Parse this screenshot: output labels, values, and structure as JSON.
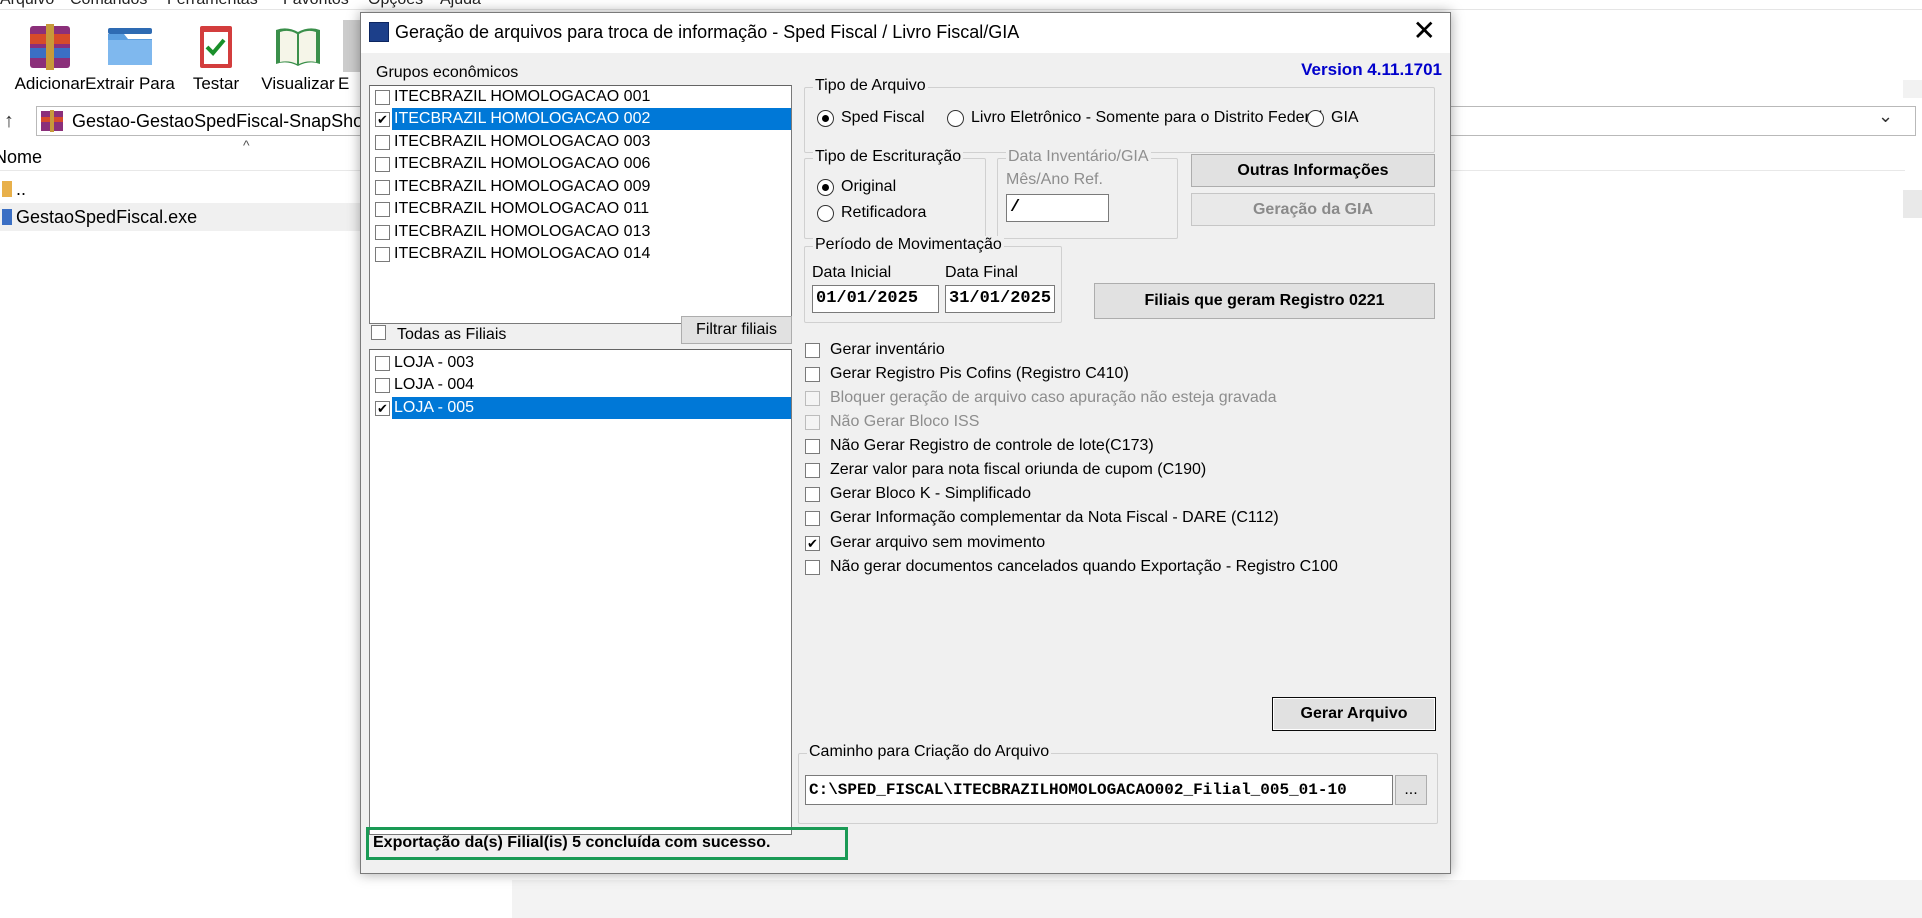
{
  "background_app": {
    "menu": [
      "Arquivo",
      "Comandos",
      "Ferramentas",
      "Favoritos",
      "Opções",
      "Ajuda"
    ],
    "toolbar": [
      {
        "label": "Adicionar",
        "icon": "add-archive-icon"
      },
      {
        "label": "Extrair Para",
        "icon": "extract-folder-icon"
      },
      {
        "label": "Testar",
        "icon": "test-clipboard-icon"
      },
      {
        "label": "Visualizar",
        "icon": "view-book-icon"
      },
      {
        "label": "E",
        "icon": "delete-icon"
      }
    ],
    "address": "Gestao-GestaoSpedFiscal-SnapShot.",
    "column_name": "Nome",
    "files": [
      "..",
      "GestaoSpedFiscal.exe"
    ]
  },
  "dialog": {
    "title": "Geração de arquivos para troca de informação - Sped Fiscal / Livro Fiscal/GIA",
    "version": "Version 4.11.1701",
    "groups_label": "Grupos econômicos",
    "groups": [
      {
        "label": "ITECBRAZIL HOMOLOGACAO 001",
        "checked": false,
        "selected": false
      },
      {
        "label": "ITECBRAZIL HOMOLOGACAO 002",
        "checked": true,
        "selected": true
      },
      {
        "label": "ITECBRAZIL HOMOLOGACAO 003",
        "checked": false,
        "selected": false
      },
      {
        "label": "ITECBRAZIL HOMOLOGACAO 006",
        "checked": false,
        "selected": false
      },
      {
        "label": "ITECBRAZIL HOMOLOGACAO 009",
        "checked": false,
        "selected": false
      },
      {
        "label": "ITECBRAZIL HOMOLOGACAO 011",
        "checked": false,
        "selected": false
      },
      {
        "label": "ITECBRAZIL HOMOLOGACAO 013",
        "checked": false,
        "selected": false
      },
      {
        "label": "ITECBRAZIL HOMOLOGACAO 014",
        "checked": false,
        "selected": false
      }
    ],
    "all_branches_label": "Todas as Filiais",
    "filter_button": "Filtrar filiais",
    "branches": [
      {
        "label": "LOJA - 003",
        "checked": false,
        "selected": false
      },
      {
        "label": "LOJA - 004",
        "checked": false,
        "selected": false
      },
      {
        "label": "LOJA - 005",
        "checked": true,
        "selected": true
      }
    ],
    "file_type": {
      "title": "Tipo de Arquivo",
      "options": [
        "Sped Fiscal",
        "Livro Eletrônico - Somente para o Distrito Federal",
        "GIA"
      ],
      "selected": "Sped Fiscal"
    },
    "bookkeeping": {
      "title": "Tipo de Escrituração",
      "options": [
        "Original",
        "Retificadora"
      ],
      "selected": "Original"
    },
    "inventory": {
      "title": "Data Inventário/GIA",
      "month_label": "Mês/Ano Ref.",
      "value": "/"
    },
    "other_info_button": "Outras Informações",
    "gia_button": "Geração da GIA",
    "period": {
      "title": "Período de Movimentação",
      "start_label": "Data Inicial",
      "end_label": "Data Final",
      "start": "01/01/2025",
      "end": "31/01/2025"
    },
    "branches_0221_button": "Filiais que geram Registro 0221",
    "options": [
      {
        "label": "Gerar inventário",
        "checked": false,
        "enabled": true
      },
      {
        "label": "Gerar Registro Pis Cofins (Registro C410)",
        "checked": false,
        "enabled": true
      },
      {
        "label": "Bloquer geração de arquivo caso apuração não esteja gravada",
        "checked": false,
        "enabled": false
      },
      {
        "label": "Não Gerar Bloco ISS",
        "checked": false,
        "enabled": false
      },
      {
        "label": "Não Gerar Registro de controle de lote(C173)",
        "checked": false,
        "enabled": true
      },
      {
        "label": "Zerar valor para nota fiscal oriunda de cupom (C190)",
        "checked": false,
        "enabled": true
      },
      {
        "label": "Gerar Bloco K  -  Simplificado",
        "checked": false,
        "enabled": true
      },
      {
        "label": "Gerar Informação complementar da Nota Fiscal - DARE (C112)",
        "checked": false,
        "enabled": true
      },
      {
        "label": "Gerar arquivo sem movimento",
        "checked": true,
        "enabled": true
      },
      {
        "label": "Não gerar documentos cancelados quando Exportação - Registro C100",
        "checked": false,
        "enabled": true
      }
    ],
    "generate_button": "Gerar Arquivo",
    "path": {
      "title": "Caminho para Criação do Arquivo",
      "value": "C:\\SPED_FISCAL\\ITECBRAZILHOMOLOGACAO002_Filial_005_01-10",
      "browse": "..."
    },
    "status": "Exportação da(s) Filial(is) 5 concluída com sucesso."
  }
}
